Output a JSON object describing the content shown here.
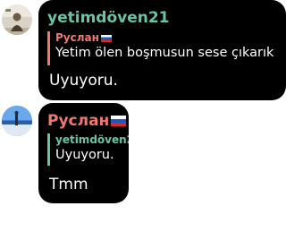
{
  "messages": [
    {
      "sender": "yetimdöven21",
      "sender_color": "#68c5a3",
      "reply": {
        "author": "Руслан",
        "author_color": "#f2776e",
        "author_flag": "russia-flag-icon",
        "text": "Yetim ölen boşmusun sese çıkarık"
      },
      "text": "Uyuyoru."
    },
    {
      "sender": "Руслан",
      "sender_color": "#f2776e",
      "sender_flag": "russia-flag-icon",
      "reply": {
        "author": "yetimdöven2",
        "author_color": "#68c5a3",
        "text": "Uyuyoru."
      },
      "text": "Tmm"
    }
  ],
  "colors": {
    "bubble_background": "#000000",
    "page_background": "#ffffff"
  }
}
